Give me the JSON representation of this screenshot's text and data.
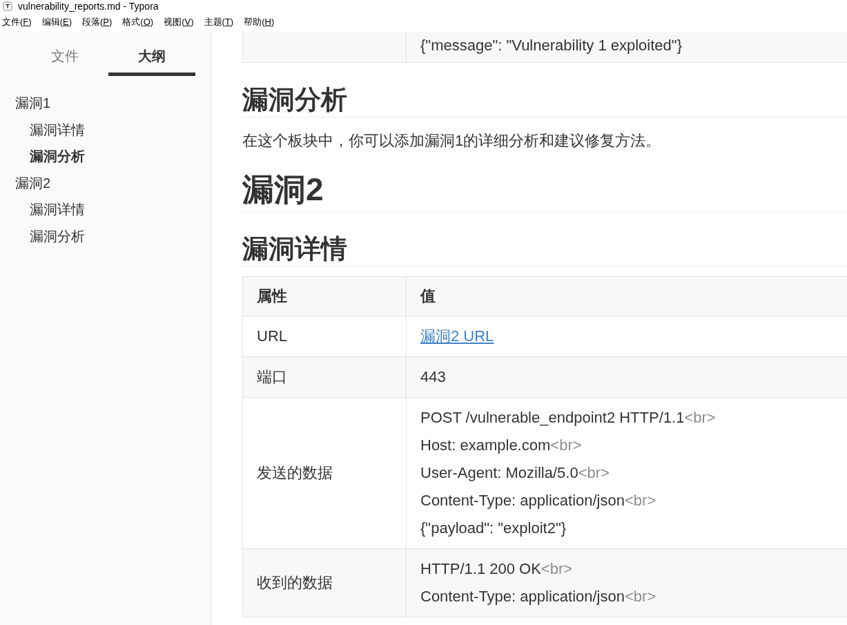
{
  "window": {
    "title": "vulnerability_reports.md - Typora"
  },
  "menu": [
    {
      "label": "文件(",
      "accelerator": "F",
      "suffix": ")"
    },
    {
      "label": "编辑(",
      "accelerator": "E",
      "suffix": ")"
    },
    {
      "label": "段落(",
      "accelerator": "P",
      "suffix": ")"
    },
    {
      "label": "格式(",
      "accelerator": "O",
      "suffix": ")"
    },
    {
      "label": "视图(",
      "accelerator": "V",
      "suffix": ")"
    },
    {
      "label": "主题(",
      "accelerator": "T",
      "suffix": ")"
    },
    {
      "label": "帮助(",
      "accelerator": "H",
      "suffix": ")"
    }
  ],
  "sidebar": {
    "tabs": [
      {
        "label": "文件",
        "selected": false
      },
      {
        "label": "大纲",
        "selected": true
      }
    ],
    "outline": [
      {
        "label": "漏洞1",
        "selected": false,
        "children": [
          {
            "label": "漏洞详情",
            "selected": false
          },
          {
            "label": "漏洞分析",
            "selected": true
          }
        ]
      },
      {
        "label": "漏洞2",
        "selected": false,
        "children": [
          {
            "label": "漏洞详情",
            "selected": false
          },
          {
            "label": "漏洞分析",
            "selected": false
          }
        ]
      }
    ]
  },
  "document": [
    {
      "kind": "table",
      "rows": [
        [
          {},
          {
            "lines": [
              {
                "text": "{\"message\": \"Vulnerability 1 exploited\"}"
              }
            ]
          }
        ]
      ]
    },
    {
      "kind": "h2",
      "text": "漏洞分析"
    },
    {
      "kind": "paragraph",
      "text": "在这个板块中，你可以添加漏洞1的详细分析和建议修复方法。"
    },
    {
      "kind": "h1",
      "text": "漏洞2"
    },
    {
      "kind": "h2",
      "text": "漏洞详情"
    },
    {
      "kind": "table",
      "header": [
        "属性",
        "值"
      ],
      "rows": [
        [
          {
            "lines": [
              {
                "text": "URL"
              }
            ]
          },
          {
            "lines": [
              {
                "text": "漏洞2 URL",
                "link": true
              }
            ]
          }
        ],
        [
          {
            "lines": [
              {
                "text": "端口"
              }
            ]
          },
          {
            "lines": [
              {
                "text": "443"
              }
            ]
          }
        ],
        [
          {
            "lines": [
              {
                "text": "发送的数据"
              }
            ]
          },
          {
            "lines": [
              {
                "text": "POST /vulnerable_endpoint2 HTTP/1.1",
                "tag": "<br>"
              },
              {
                "text": "Host: example.com",
                "tag": "<br>"
              },
              {
                "text": "User-Agent: Mozilla/5.0",
                "tag": "<br>"
              },
              {
                "text": "Content-Type: application/json",
                "tag": "<br>"
              },
              {
                "text": "{\"payload\": \"exploit2\"}"
              }
            ]
          }
        ],
        [
          {
            "lines": [
              {
                "text": "收到的数据"
              }
            ]
          },
          {
            "lines": [
              {
                "text": "HTTP/1.1 200 OK",
                "tag": "<br>"
              },
              {
                "text": "Content-Type: application/json",
                "tag": "<br>"
              }
            ]
          }
        ]
      ]
    }
  ]
}
